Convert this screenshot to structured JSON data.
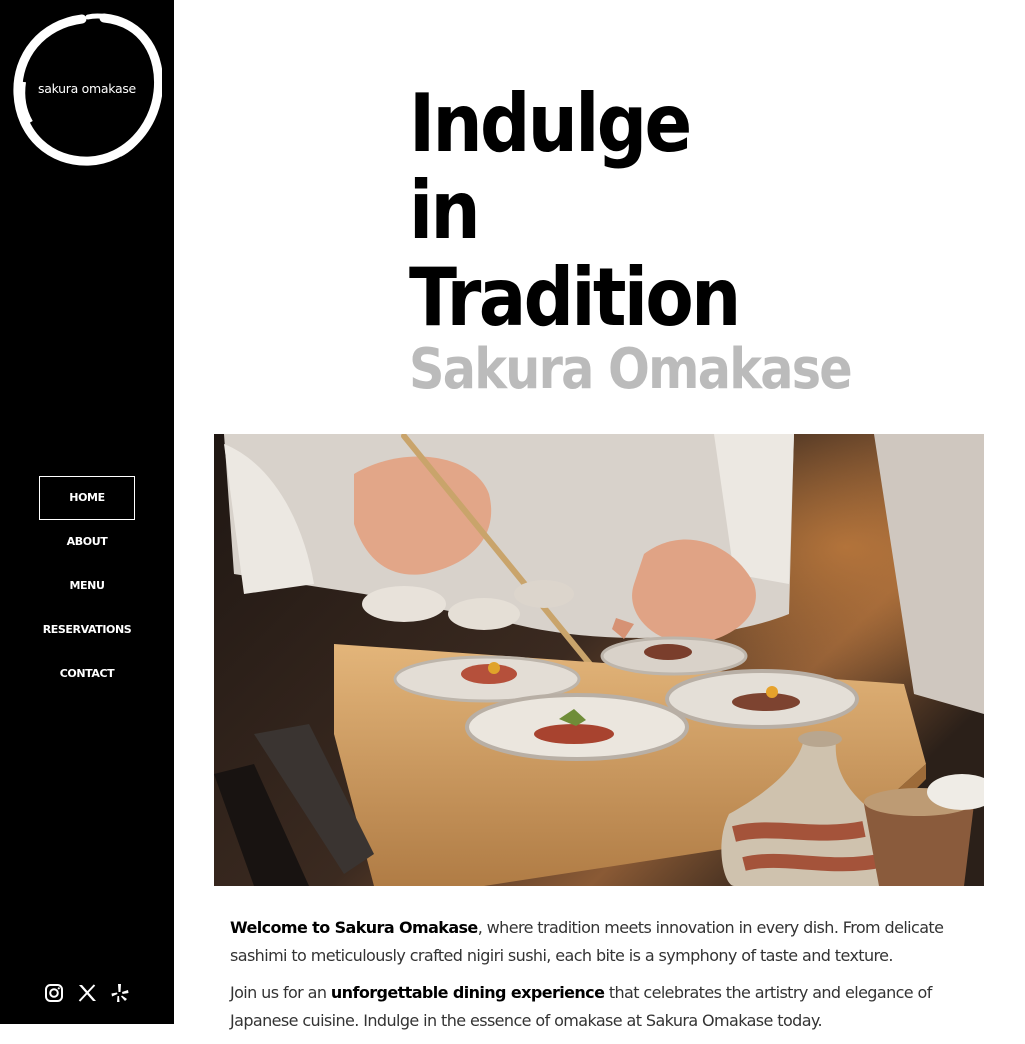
{
  "brand": {
    "logo_text": "sakura omakase"
  },
  "nav": {
    "items": [
      {
        "label": "HOME",
        "active": true
      },
      {
        "label": "ABOUT"
      },
      {
        "label": "MENU"
      },
      {
        "label": "RESERVATIONS"
      },
      {
        "label": "CONTACT"
      }
    ]
  },
  "social": {
    "icons": [
      "instagram-icon",
      "x-icon",
      "yelp-icon"
    ]
  },
  "hero": {
    "line1": "Indulge",
    "line2": "in",
    "line3": "Tradition",
    "subtitle": "Sakura Omakase"
  },
  "intro": {
    "p1_strong": "Welcome to Sakura Omakase",
    "p1_rest": ", where tradition meets innovation in every dish. From delicate sashimi to meticulously crafted nigiri sushi, each bite is a symphony of taste and texture.",
    "p2_start": "Join us for an ",
    "p2_strong": "unforgettable dining experience",
    "p2_rest": " that celebrates the artistry and elegance of Japanese cuisine. Indulge in the essence of omakase at Sakura Omakase today."
  },
  "colors": {
    "sidebar_bg": "#000000",
    "hero_text": "#000000",
    "subtitle": "#bbbbbb"
  }
}
